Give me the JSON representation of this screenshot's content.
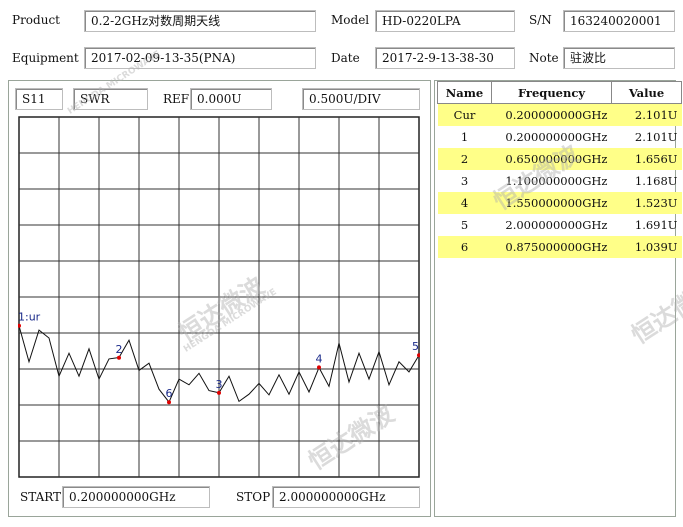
{
  "header": {
    "product_label": "Product",
    "product_value": "0.2-2GHz对数周期天线",
    "model_label": "Model",
    "model_value": "HD-0220LPA",
    "sn_label": "S/N",
    "sn_value": "163240020001",
    "equipment_label": "Equipment",
    "equipment_value": "2017-02-09-13-35(PNA)",
    "date_label": "Date",
    "date_value": "2017-2-9-13-38-30",
    "note_label": "Note",
    "note_value": "驻波比"
  },
  "measurement": {
    "param": "S11",
    "format": "SWR",
    "ref_label": "REF",
    "ref_value": "0.000U",
    "scale_value": "0.500U/DIV",
    "start_label": "START",
    "start_value": "0.200000000GHz",
    "stop_label": "STOP",
    "stop_value": "2.000000000GHz"
  },
  "marker_table": {
    "headers": [
      "Name",
      "Frequency",
      "Value"
    ],
    "rows": [
      {
        "name": "Cur",
        "frequency": "0.200000000GHz",
        "value": "2.101U",
        "highlight": true
      },
      {
        "name": "1",
        "frequency": "0.200000000GHz",
        "value": "2.101U",
        "highlight": false
      },
      {
        "name": "2",
        "frequency": "0.650000000GHz",
        "value": "1.656U",
        "highlight": true
      },
      {
        "name": "3",
        "frequency": "1.100000000GHz",
        "value": "1.168U",
        "highlight": false
      },
      {
        "name": "4",
        "frequency": "1.550000000GHz",
        "value": "1.523U",
        "highlight": true
      },
      {
        "name": "5",
        "frequency": "2.000000000GHz",
        "value": "1.691U",
        "highlight": false
      },
      {
        "name": "6",
        "frequency": "0.875000000GHz",
        "value": "1.039U",
        "highlight": true
      }
    ]
  },
  "watermark": {
    "text": "恒达微波",
    "subtext": "HENGDA MICROWAVE"
  },
  "chart_data": {
    "type": "line",
    "xlim": [
      0.2,
      2.0
    ],
    "ylim": [
      0,
      5
    ],
    "x_divisions": 10,
    "y_divisions": 10,
    "grid": true,
    "series": [
      {
        "x": [
          0.2,
          0.245,
          0.29,
          0.335,
          0.38,
          0.425,
          0.47,
          0.515,
          0.56,
          0.605,
          0.65,
          0.695,
          0.74,
          0.785,
          0.83,
          0.875,
          0.92,
          0.965,
          1.01,
          1.055,
          1.1,
          1.145,
          1.19,
          1.235,
          1.28,
          1.325,
          1.37,
          1.415,
          1.46,
          1.505,
          1.55,
          1.595,
          1.64,
          1.685,
          1.73,
          1.775,
          1.82,
          1.865,
          1.91,
          1.955,
          2.0
        ],
        "y": [
          2.1,
          1.6,
          2.04,
          1.93,
          1.4,
          1.72,
          1.4,
          1.78,
          1.36,
          1.64,
          1.66,
          1.9,
          1.48,
          1.58,
          1.22,
          1.04,
          1.36,
          1.28,
          1.44,
          1.2,
          1.17,
          1.4,
          1.05,
          1.15,
          1.3,
          1.14,
          1.42,
          1.15,
          1.46,
          1.18,
          1.52,
          1.26,
          1.86,
          1.32,
          1.72,
          1.36,
          1.74,
          1.28,
          1.6,
          1.46,
          1.69
        ]
      }
    ],
    "markers": [
      {
        "label": "1:ur",
        "x": 0.2,
        "y": 2.101
      },
      {
        "label": "2",
        "x": 0.65,
        "y": 1.656
      },
      {
        "label": "3",
        "x": 1.1,
        "y": 1.168
      },
      {
        "label": "4",
        "x": 1.55,
        "y": 1.523
      },
      {
        "label": "5",
        "x": 2.0,
        "y": 1.691
      },
      {
        "label": "6",
        "x": 0.875,
        "y": 1.039
      }
    ]
  }
}
